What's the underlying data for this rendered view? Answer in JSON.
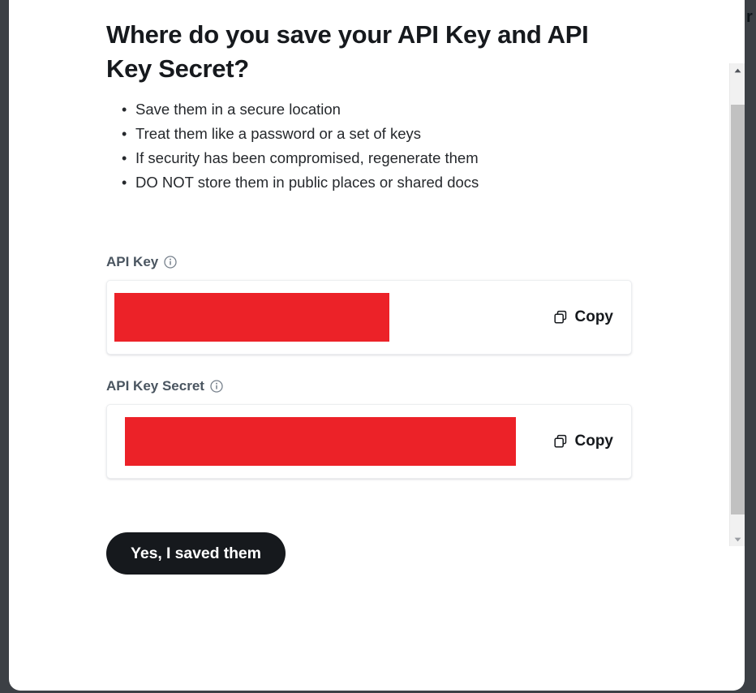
{
  "dialog": {
    "title": "Where do you save your API Key and API Key Secret?",
    "tips": [
      "Save them in a secure location",
      "Treat them like a password or a set of keys",
      "If security has been compromised, regenerate them",
      "DO NOT store them in public places or shared docs"
    ],
    "confirm_label": "Yes, I saved them"
  },
  "fields": {
    "api_key": {
      "label": "API Key",
      "info_icon": "info-circle-icon",
      "value": "",
      "value_masked": true,
      "copy_label": "Copy",
      "copy_icon": "copy-icon"
    },
    "api_key_secret": {
      "label": "API Key Secret",
      "info_icon": "info-circle-icon",
      "value": "",
      "value_masked": true,
      "copy_label": "Copy",
      "copy_icon": "copy-icon"
    }
  },
  "scrollbar": {
    "up_icon": "triangle-up-icon",
    "down_icon": "triangle-down-icon",
    "thumb": "scrollbar-thumb"
  },
  "right_panel": {
    "clipped_glyph": "r"
  },
  "colors": {
    "redaction": "#ec2228",
    "button_bg": "#16191d",
    "label_text": "#4a5560",
    "body_text": "#25282c",
    "chrome_dark": "#3c4045",
    "scrollbar_track": "#f1f1f1",
    "scrollbar_thumb": "#c1c1c1"
  }
}
